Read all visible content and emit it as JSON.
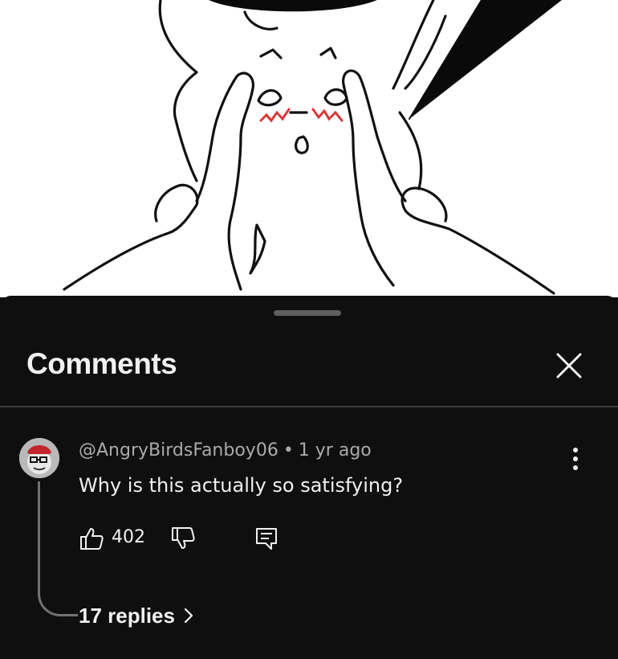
{
  "sheet": {
    "title": "Comments"
  },
  "comment": {
    "author": "@AngryBirdsFanboy06",
    "separator": "•",
    "time": "1 yr ago",
    "text": "Why is this actually so satisfying?",
    "likes": "402",
    "replies_label": "17 replies"
  },
  "icons": {
    "close": "close-icon",
    "more": "more-vert-icon",
    "like": "thumbs-up-icon",
    "dislike": "thumbs-down-icon",
    "reply": "reply-comment-icon",
    "chevron": "chevron-right-icon"
  },
  "colors": {
    "background": "#0f0f0f",
    "text": "#f1f1f1",
    "secondary_text": "#aaaaaa",
    "divider": "#3a3a3a",
    "blush": "#d83a3a"
  }
}
